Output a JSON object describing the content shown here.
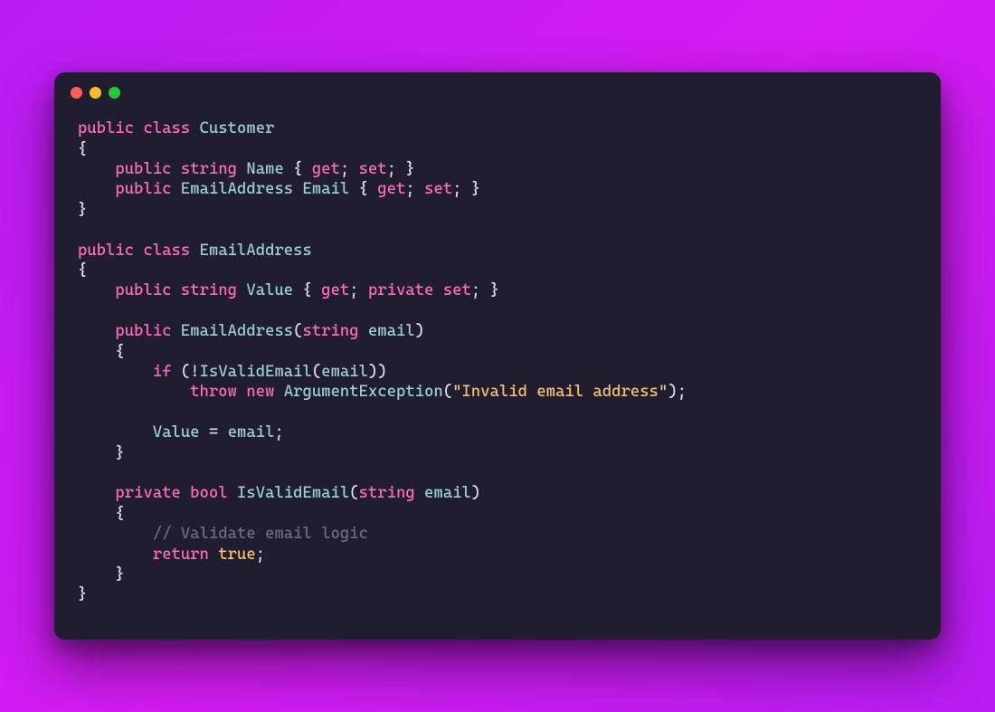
{
  "colors": {
    "background_gradient_start": "#b81cf2",
    "background_gradient_end": "#b81cf2",
    "window_bg": "#1f1d2e",
    "keyword": "#ff6ac1",
    "type": "#9ccfd8",
    "string": "#f6c177",
    "comment": "#6e6a86",
    "punctuation": "#e0def4",
    "dot_red": "#ff5f56",
    "dot_yellow": "#ffbd2e",
    "dot_green": "#27c93f"
  },
  "kw": {
    "public": "public",
    "class": "class",
    "string": "string",
    "get": "get",
    "set": "set",
    "private": "private",
    "if": "if",
    "throw": "throw",
    "new": "new",
    "bool": "bool",
    "return": "return",
    "true": "true"
  },
  "ident": {
    "Customer": "Customer",
    "Name": "Name",
    "EmailAddress": "EmailAddress",
    "Email": "Email",
    "Value": "Value",
    "email": "email",
    "IsValidEmail": "IsValidEmail",
    "ArgumentException": "ArgumentException"
  },
  "str": {
    "invalid_email": "\"Invalid email address\""
  },
  "cmt": {
    "validate": "// Validate email logic"
  },
  "code_plain": "public class Customer\n{\n    public string Name { get; set; }\n    public EmailAddress Email { get; set; }\n}\n\npublic class EmailAddress\n{\n    public string Value { get; private set; }\n\n    public EmailAddress(string email)\n    {\n        if (!IsValidEmail(email))\n            throw new ArgumentException(\"Invalid email address\");\n\n        Value = email;\n    }\n\n    private bool IsValidEmail(string email)\n    {\n        // Validate email logic\n        return true;\n    }\n}"
}
